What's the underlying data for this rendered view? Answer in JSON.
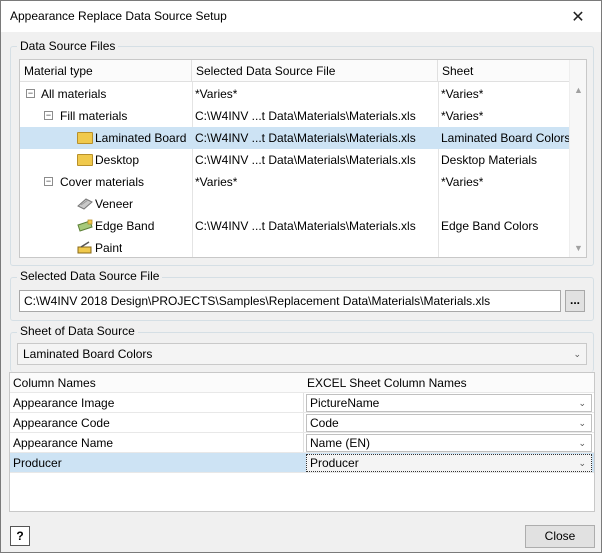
{
  "window": {
    "title": "Appearance Replace Data Source Setup",
    "close_glyph": "✕"
  },
  "data_source_files": {
    "label": "Data Source Files",
    "columns": [
      "Material type",
      "Selected Data Source File",
      "Sheet"
    ],
    "rows": [
      {
        "name": "All materials",
        "file": "*Varies*",
        "sheet": "*Varies*",
        "icon": "collapse-icon"
      },
      {
        "name": "Fill materials",
        "file": "C:\\W4INV ...t Data\\Materials\\Materials.xls",
        "sheet": "*Varies*",
        "icon": "collapse-icon"
      },
      {
        "name": "Laminated Board",
        "file": "C:\\W4INV ...t Data\\Materials\\Materials.xls",
        "sheet": "Laminated Board Colors",
        "icon": "folder-icon"
      },
      {
        "name": "Desktop",
        "file": "C:\\W4INV ...t Data\\Materials\\Materials.xls",
        "sheet": "Desktop Materials",
        "icon": "folder-icon"
      },
      {
        "name": "Cover materials",
        "file": "*Varies*",
        "sheet": "*Varies*",
        "icon": "collapse-icon"
      },
      {
        "name": "Veneer",
        "file": "",
        "sheet": "",
        "icon": "veneer-icon"
      },
      {
        "name": "Edge Band",
        "file": "C:\\W4INV ...t Data\\Materials\\Materials.xls",
        "sheet": "Edge Band Colors",
        "icon": "edge-band-icon"
      },
      {
        "name": "Paint",
        "file": "",
        "sheet": "",
        "icon": "paint-icon"
      }
    ]
  },
  "selected_file": {
    "label": "Selected Data Source File",
    "value": "C:\\W4INV 2018 Design\\PROJECTS\\Samples\\Replacement Data\\Materials\\Materials.xls",
    "browse_label": "..."
  },
  "sheet": {
    "label": "Sheet of Data Source",
    "value": "Laminated Board Colors"
  },
  "columns_map": {
    "headers": [
      "Column Names",
      "EXCEL Sheet Column Names"
    ],
    "rows": [
      {
        "name": "Appearance Image",
        "value": "PictureName"
      },
      {
        "name": "Appearance Code",
        "value": "Code"
      },
      {
        "name": "Appearance Name",
        "value": "Name (EN)"
      },
      {
        "name": "Producer",
        "value": "Producer"
      }
    ]
  },
  "buttons": {
    "help": "?",
    "close": "Close"
  }
}
